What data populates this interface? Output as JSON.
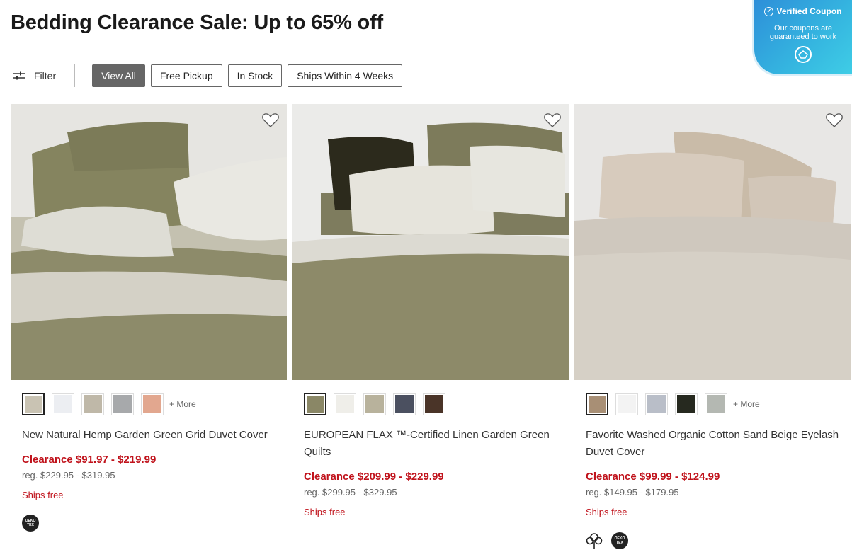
{
  "page": {
    "title": "Bedding Clearance Sale: Up to 65% off"
  },
  "coupon": {
    "title": "Verified Coupon",
    "subtitle": "Our coupons are guaranteed to work",
    "icon": "check-circle-icon"
  },
  "filters": {
    "filter_label": "Filter",
    "chips": [
      {
        "label": "View All",
        "active": true
      },
      {
        "label": "Free Pickup",
        "active": false
      },
      {
        "label": "In Stock",
        "active": false
      },
      {
        "label": "Ships Within 4 Weeks",
        "active": false
      }
    ]
  },
  "products": [
    {
      "name": "New Natural Hemp Garden Green Grid Duvet Cover",
      "sale": "Clearance $91.97 - $219.99",
      "reg": "reg. $229.95 - $319.95",
      "ships": "Ships free",
      "more": "+ More",
      "swatches": [
        "#c9c3b3",
        "#eceef2",
        "#bfb8a8",
        "#a7a9ab",
        "#e2a78f"
      ],
      "badges": [
        "oeko-tex"
      ],
      "oeko_text": "OEKO TEX"
    },
    {
      "name": "EUROPEAN FLAX ™-Certified Linen Garden Green Quilts",
      "sale": "Clearance $209.99 - $229.99",
      "reg": "reg. $299.95 - $329.95",
      "ships": "Ships free",
      "more": "",
      "swatches": [
        "#8a8766",
        "#efeee9",
        "#b8b29c",
        "#4b5060",
        "#4a3428"
      ],
      "badges": []
    },
    {
      "name": "Favorite Washed Organic Cotton Sand Beige Eyelash Duvet Cover",
      "sale": "Clearance $99.99 - $124.99",
      "reg": "reg. $149.95 - $179.95",
      "ships": "Ships free",
      "more": "+ More",
      "swatches": [
        "#a88f75",
        "#f3f3f3",
        "#b9bec8",
        "#26291f",
        "#b4b8b2"
      ],
      "badges": [
        "organic-cotton",
        "oeko-tex"
      ],
      "oeko_text": "OEKO TEX"
    }
  ]
}
